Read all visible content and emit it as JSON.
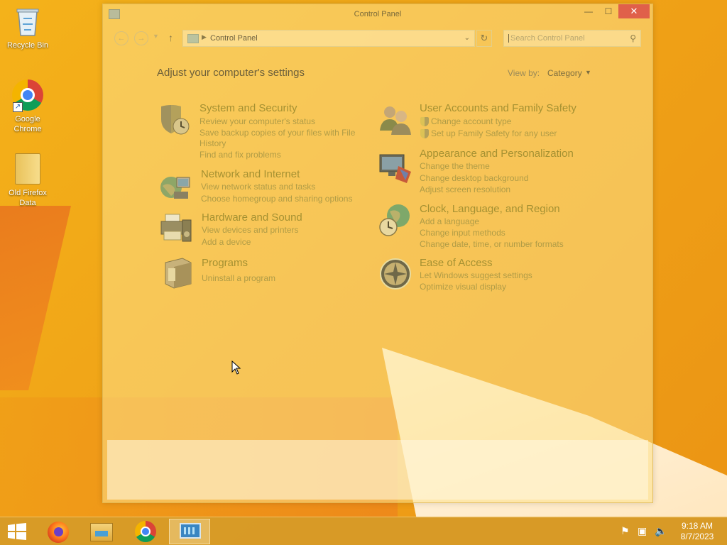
{
  "desktop": {
    "icons": [
      {
        "label": "Recycle Bin",
        "icon": "recycle-bin-icon"
      },
      {
        "label": "Google Chrome",
        "icon": "chrome-icon"
      },
      {
        "label": "Old Firefox Data",
        "icon": "folder-icon"
      }
    ]
  },
  "window": {
    "title": "Control Panel",
    "buttons": {
      "minimize": "—",
      "maximize": "☐",
      "close": "✕"
    }
  },
  "address": {
    "path": "Control Panel",
    "search_placeholder": "Search Control Panel"
  },
  "content": {
    "heading": "Adjust your computer's settings",
    "view_by_label": "View by:",
    "view_by_value": "Category",
    "categories": [
      {
        "title": "System and Security",
        "icon": "shield-clock-icon",
        "links": [
          "Review your computer's status",
          "Save backup copies of your files with File",
          "History",
          "Find and fix problems"
        ]
      },
      {
        "title": "Network and Internet",
        "icon": "globe-network-icon",
        "links": [
          "View network status and tasks",
          "Choose homegroup and sharing options"
        ]
      },
      {
        "title": "Hardware and Sound",
        "icon": "printer-speaker-icon",
        "links": [
          "View devices and printers",
          "Add a device"
        ]
      },
      {
        "title": "Programs",
        "icon": "programs-box-icon",
        "links": [
          "Uninstall a program"
        ]
      },
      {
        "title": "User Accounts and Family Safety",
        "icon": "users-icon",
        "links": [
          "Change account type",
          "Set up Family Safety for any user"
        ]
      },
      {
        "title": "Appearance and Personalization",
        "icon": "monitor-palette-icon",
        "links": [
          "Change the theme",
          "Change desktop background",
          "Adjust screen resolution"
        ]
      },
      {
        "title": "Clock, Language, and Region",
        "icon": "clock-globe-icon",
        "links": [
          "Add a language",
          "Change input methods",
          "Change date, time, or number formats"
        ]
      },
      {
        "title": "Ease of Access",
        "icon": "ease-of-access-icon",
        "links": [
          "Let Windows suggest settings",
          "Optimize visual display"
        ]
      }
    ]
  },
  "taskbar": {
    "items": [
      "start-icon",
      "firefox-icon",
      "file-explorer-icon",
      "chrome-icon",
      "control-panel-icon"
    ],
    "clock": {
      "time": "9:18 AM",
      "date": "8/7/2023"
    }
  },
  "colors": {
    "accent": "#a59132",
    "link": "#b09c46",
    "close_button": "#e0604a",
    "wallpaper": "#f0a317"
  }
}
